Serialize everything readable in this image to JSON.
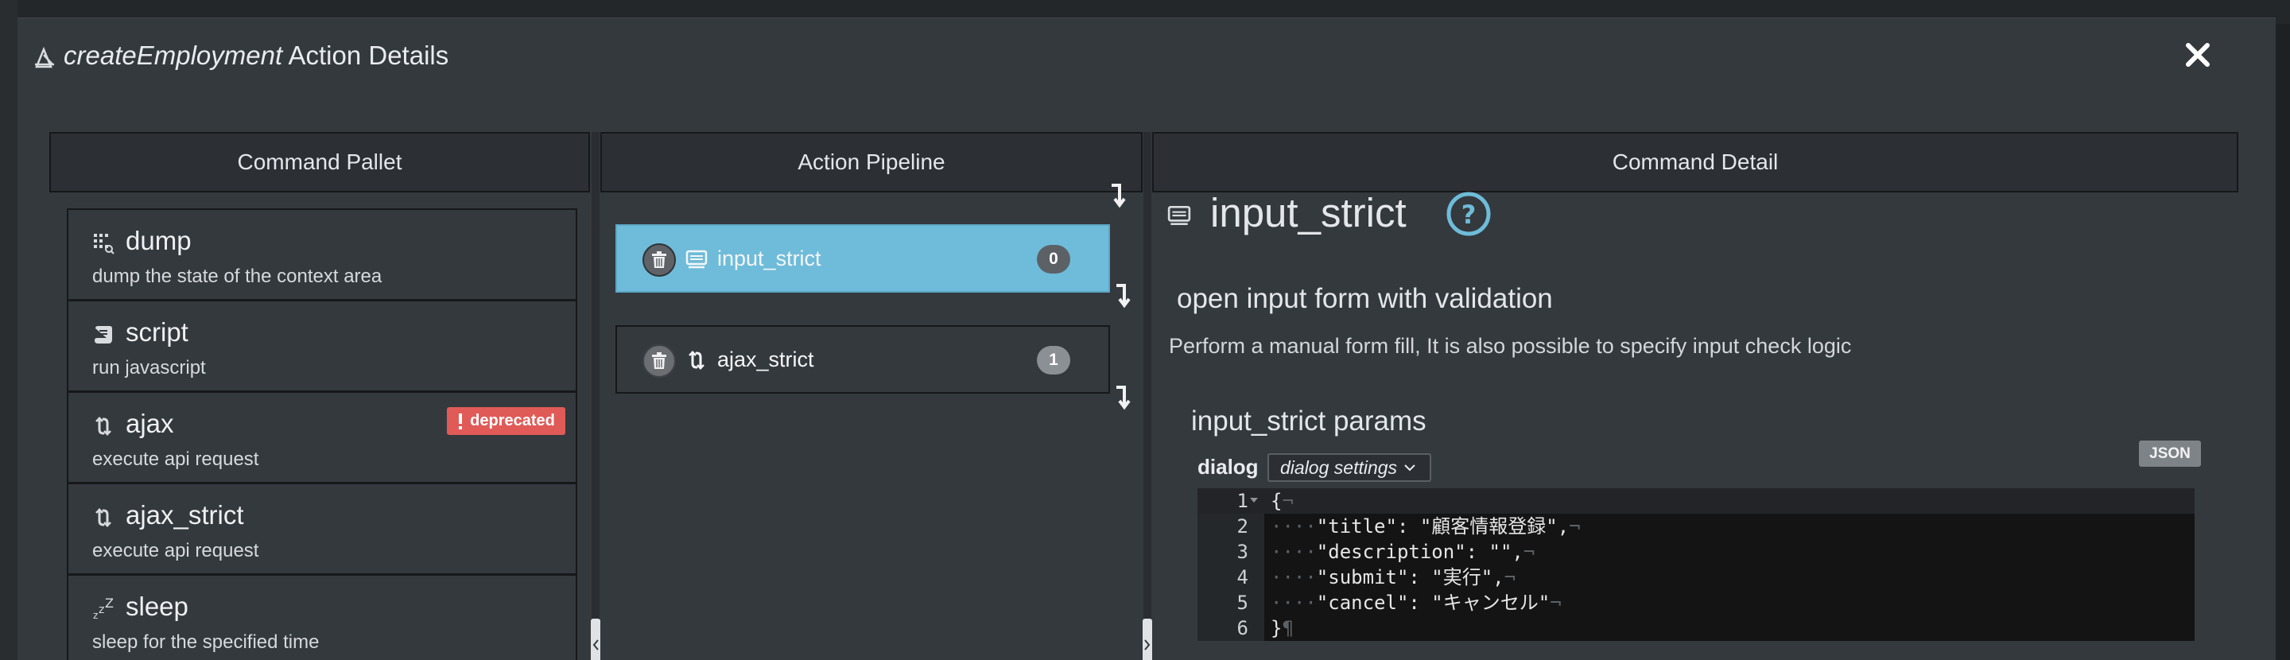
{
  "modal": {
    "title_italic": "createEmployment",
    "title_rest": " Action Details",
    "close_glyph": "✕"
  },
  "panels": {
    "pallet": "Command Pallet",
    "pipeline": "Action Pipeline",
    "detail": "Command Detail"
  },
  "pallet_items": [
    {
      "name": "dump",
      "desc": "dump the state of the context area",
      "icon": "dump-icon"
    },
    {
      "name": "script",
      "desc": "run javascript",
      "icon": "script-icon"
    },
    {
      "name": "ajax",
      "desc": "execute api request",
      "icon": "ajax-icon",
      "badge": "deprecated"
    },
    {
      "name": "ajax_strict",
      "desc": "execute api request",
      "icon": "ajax-icon"
    },
    {
      "name": "sleep",
      "desc": "sleep for the specified time",
      "icon": "sleep-icon"
    }
  ],
  "pipeline": [
    {
      "name": "input_strict",
      "count": "0",
      "active": true
    },
    {
      "name": "ajax_strict",
      "count": "1",
      "active": false
    }
  ],
  "detail": {
    "name": "input_strict",
    "heading": "open input form with validation",
    "description": "Perform a manual form fill, It is also possible to specify input check logic",
    "params_title": "input_strict params",
    "json_button": "JSON",
    "dialog_label": "dialog",
    "dialog_select": "dialog settings",
    "code_lines": [
      {
        "n": "1",
        "text": "{"
      },
      {
        "n": "2",
        "text": "\"title\": \"顧客情報登録\","
      },
      {
        "n": "3",
        "text": "\"description\": \"\","
      },
      {
        "n": "4",
        "text": "\"submit\": \"実行\","
      },
      {
        "n": "5",
        "text": "\"cancel\": \"キャンセル\""
      },
      {
        "n": "6",
        "text": "}"
      }
    ]
  },
  "colors": {
    "accent": "#6ebcd9",
    "deprecated": "#e05b58",
    "help": "#6ebcd9"
  }
}
